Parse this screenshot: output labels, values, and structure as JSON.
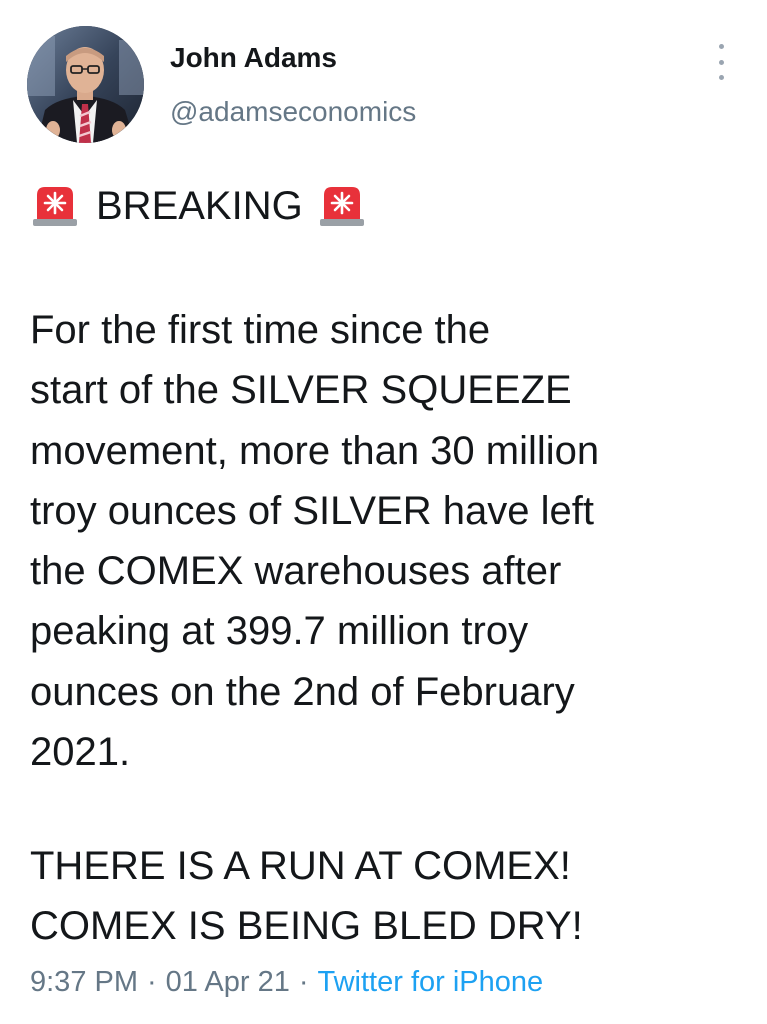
{
  "author": {
    "name": "John Adams",
    "handle": "@adamseconomics"
  },
  "tweet": {
    "headline": "BREAKING",
    "headline_icon": "police-siren-emoji",
    "body_lines": [
      "For the first time since the",
      "start of the SILVER SQUEEZE",
      "movement, more than 30 million",
      "troy ounces of SILVER have left",
      "the COMEX warehouses after",
      "peaking at 399.7 million troy",
      "ounces on the 2nd of February",
      "2021."
    ],
    "closing_lines": [
      "THERE IS A RUN AT COMEX!",
      "COMEX IS BEING BLED DRY!"
    ]
  },
  "meta": {
    "time": "9:37 PM",
    "separator": "·",
    "date": "01 Apr 21",
    "source": "Twitter for iPhone"
  },
  "colors": {
    "text": "#14171a",
    "secondary": "#657786",
    "link": "#1da1f2",
    "siren_red": "#e8313a"
  }
}
